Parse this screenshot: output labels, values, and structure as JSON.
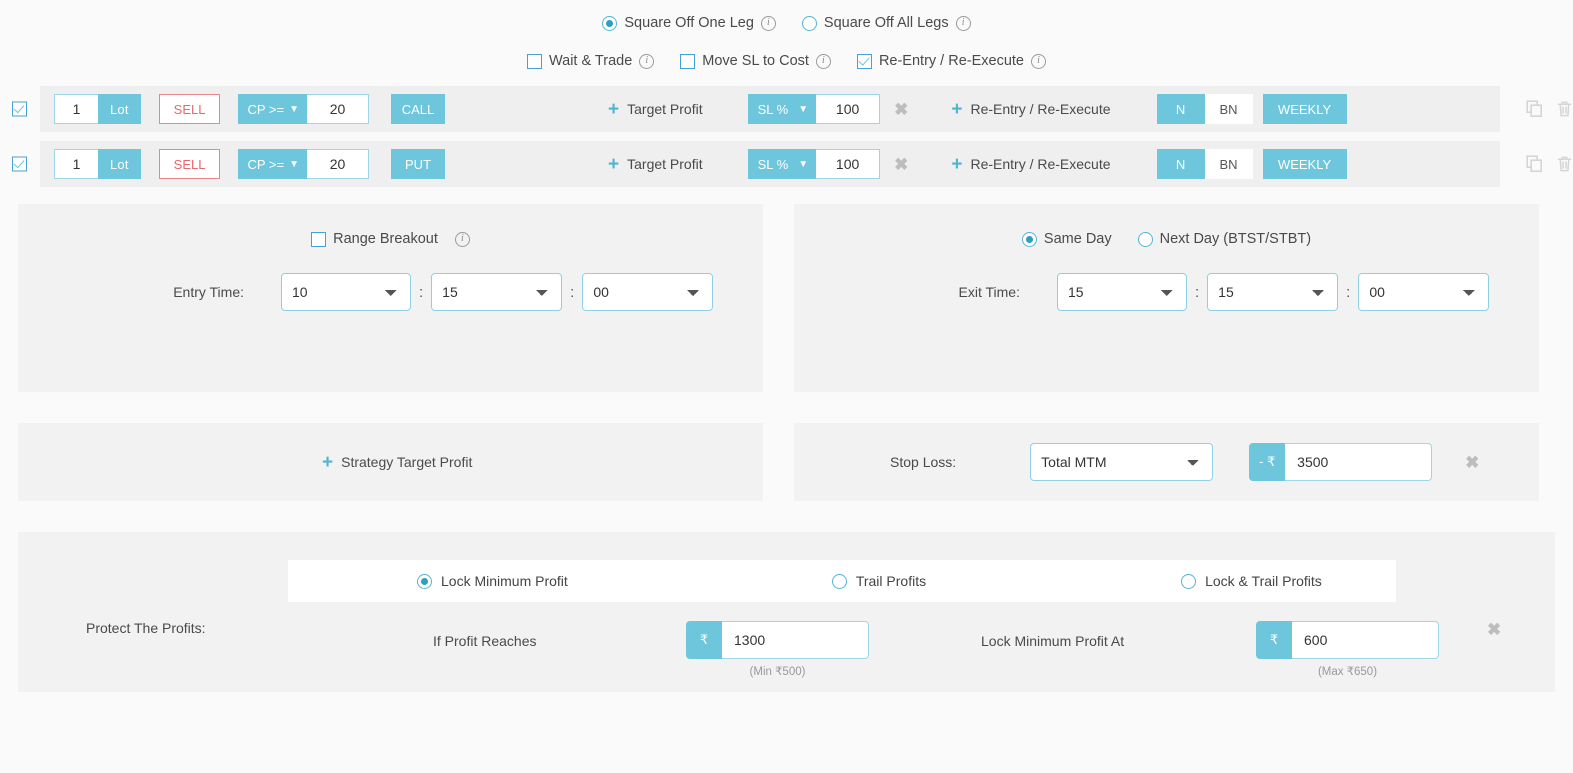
{
  "top_options": {
    "row1": [
      {
        "type": "radio",
        "label": "Square Off One Leg",
        "checked": true,
        "info": true
      },
      {
        "type": "radio",
        "label": "Square Off All Legs",
        "checked": false,
        "info": true
      }
    ],
    "row2": [
      {
        "type": "checkbox",
        "label": "Wait & Trade",
        "checked": false,
        "info": true
      },
      {
        "type": "checkbox",
        "label": "Move SL to Cost",
        "checked": false,
        "info": true
      },
      {
        "type": "checkbox",
        "label": "Re-Entry / Re-Execute",
        "checked": true,
        "info": true
      }
    ]
  },
  "legs": [
    {
      "enabled": true,
      "qty": "1",
      "qty_unit": "Lot",
      "side": "SELL",
      "strike_criteria": "CP >=",
      "strike_value": "20",
      "option_type": "CALL",
      "target_profit_label": "Target Profit",
      "sl_type": "SL %",
      "sl_value": "100",
      "reentry_label": "Re-Entry / Re-Execute",
      "index_options": [
        "N",
        "BN"
      ],
      "index_selected": "N",
      "expiry": "WEEKLY"
    },
    {
      "enabled": true,
      "qty": "1",
      "qty_unit": "Lot",
      "side": "SELL",
      "strike_criteria": "CP >=",
      "strike_value": "20",
      "option_type": "PUT",
      "target_profit_label": "Target Profit",
      "sl_type": "SL %",
      "sl_value": "100",
      "reentry_label": "Re-Entry / Re-Execute",
      "index_options": [
        "N",
        "BN"
      ],
      "index_selected": "N",
      "expiry": "WEEKLY"
    }
  ],
  "entry_card": {
    "range_breakout_label": "Range Breakout",
    "range_breakout_checked": false,
    "time_label": "Entry Time:",
    "hour": "10",
    "minute": "15",
    "second": "00"
  },
  "exit_card": {
    "day_options": [
      {
        "label": "Same Day",
        "checked": true
      },
      {
        "label": "Next Day (BTST/STBT)",
        "checked": false
      }
    ],
    "time_label": "Exit Time:",
    "hour": "15",
    "minute": "15",
    "second": "00"
  },
  "strategy_target": {
    "label": "Strategy Target Profit"
  },
  "stop_loss": {
    "label": "Stop Loss:",
    "type": "Total MTM",
    "currency_prefix": "- ₹",
    "value": "3500"
  },
  "protect_profits": {
    "tabs": [
      {
        "label": "Lock Minimum Profit",
        "checked": true
      },
      {
        "label": "Trail Profits",
        "checked": false
      },
      {
        "label": "Lock & Trail Profits",
        "checked": false
      }
    ],
    "section_label": "Protect The Profits:",
    "field1_label": "If Profit Reaches",
    "field1_prefix": "₹",
    "field1_value": "1300",
    "field1_hint": "(Min ₹500)",
    "field2_label": "Lock Minimum Profit At",
    "field2_prefix": "₹",
    "field2_value": "600",
    "field2_hint": "(Max ₹650)"
  },
  "colors": {
    "accent": "#6ec6dd",
    "sell": "#e8686d",
    "card_bg": "#f2f2f2",
    "leg_bg": "#efefef",
    "page_bg": "#fafafa"
  },
  "icons": {
    "plus": "+",
    "close": "✖",
    "copy": "copy-icon",
    "delete": "trash-icon",
    "info": "i"
  }
}
